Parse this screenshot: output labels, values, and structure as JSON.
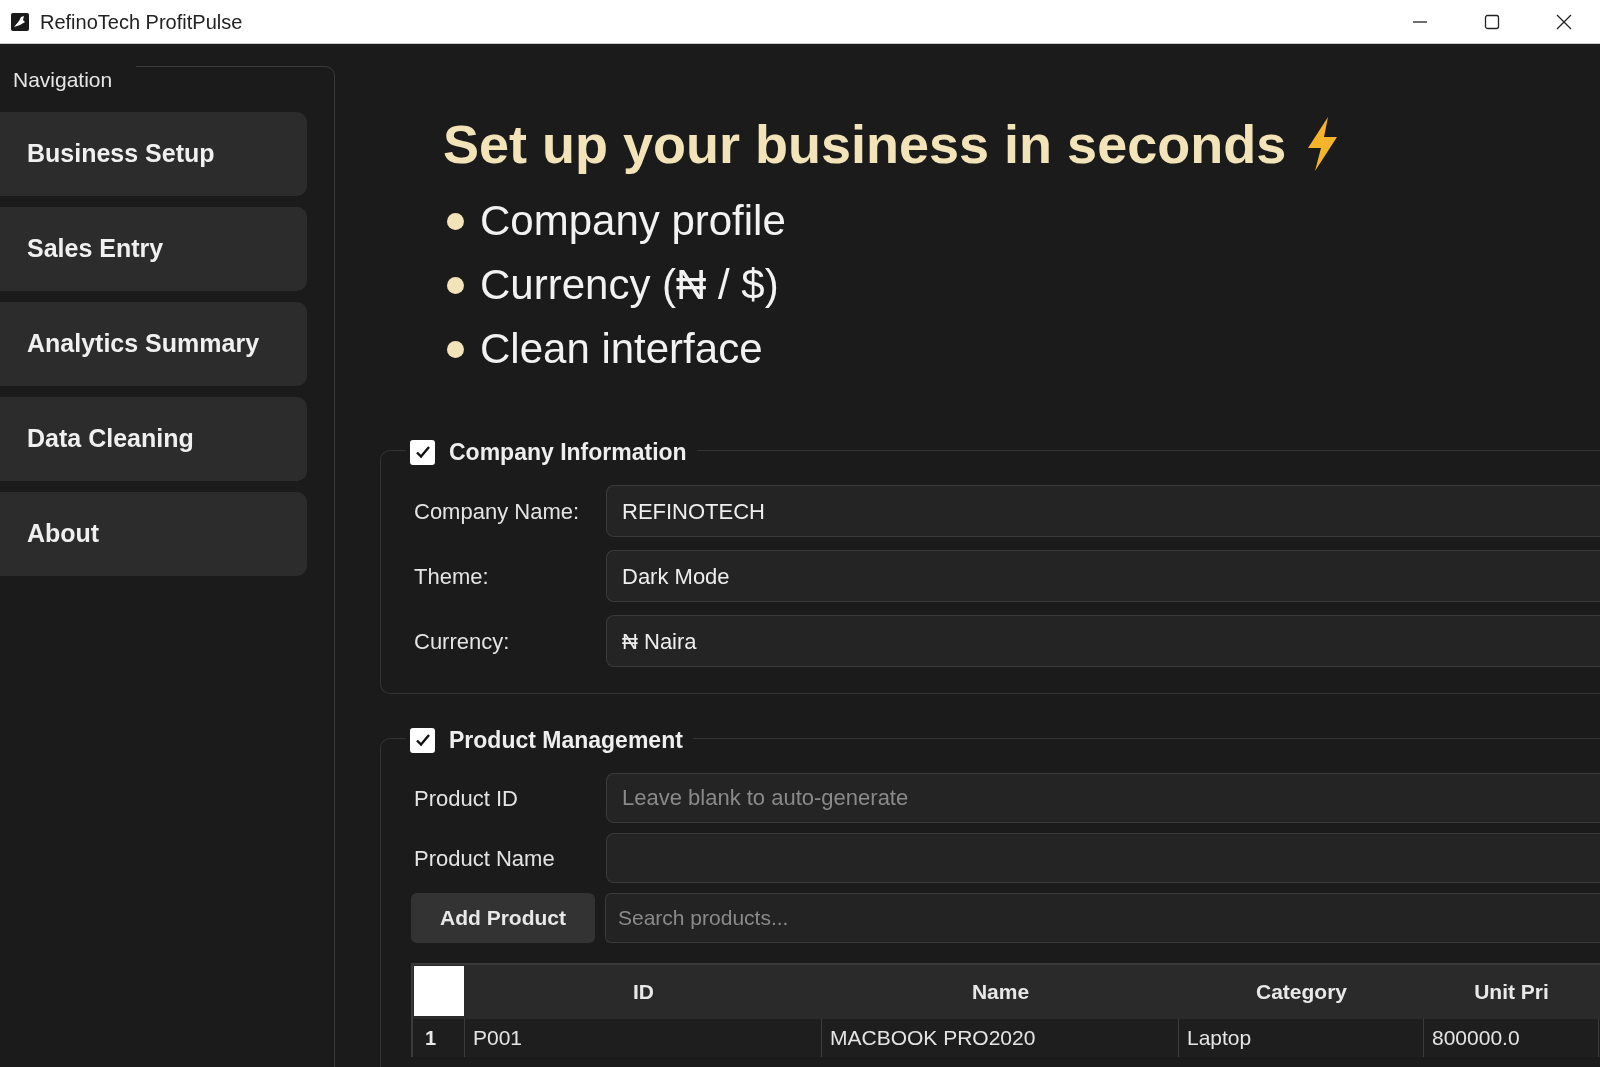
{
  "window": {
    "title": "RefinoTech ProfitPulse"
  },
  "sidebar": {
    "title": "Navigation",
    "items": [
      {
        "label": "Business Setup"
      },
      {
        "label": "Sales Entry"
      },
      {
        "label": "Analytics Summary"
      },
      {
        "label": "Data Cleaning"
      },
      {
        "label": "About"
      }
    ]
  },
  "hero": {
    "heading": "Set up your business in seconds",
    "bullets": [
      "Company profile",
      "Currency (₦ / $)",
      "Clean interface"
    ]
  },
  "company_information": {
    "title": "Company Information",
    "checked": true,
    "fields": [
      {
        "label": "Company Name:",
        "value": "REFINOTECH"
      },
      {
        "label": "Theme:",
        "value": "Dark Mode"
      },
      {
        "label": "Currency:",
        "value": "₦ Naira"
      }
    ]
  },
  "product_management": {
    "title": "Product Management",
    "checked": true,
    "fields": [
      {
        "label": "Product ID",
        "placeholder": "Leave blank to auto-generate"
      },
      {
        "label": "Product Name"
      }
    ],
    "add_button": "Add Product",
    "search": {
      "placeholder": "Search products..."
    },
    "table": {
      "columns": [
        "ID",
        "Name",
        "Category",
        "Unit Pri"
      ],
      "rows": [
        {
          "number": "1",
          "cells": [
            "P001",
            "MACBOOK PRO2020",
            "Laptop",
            "800000.0"
          ]
        }
      ]
    }
  }
}
